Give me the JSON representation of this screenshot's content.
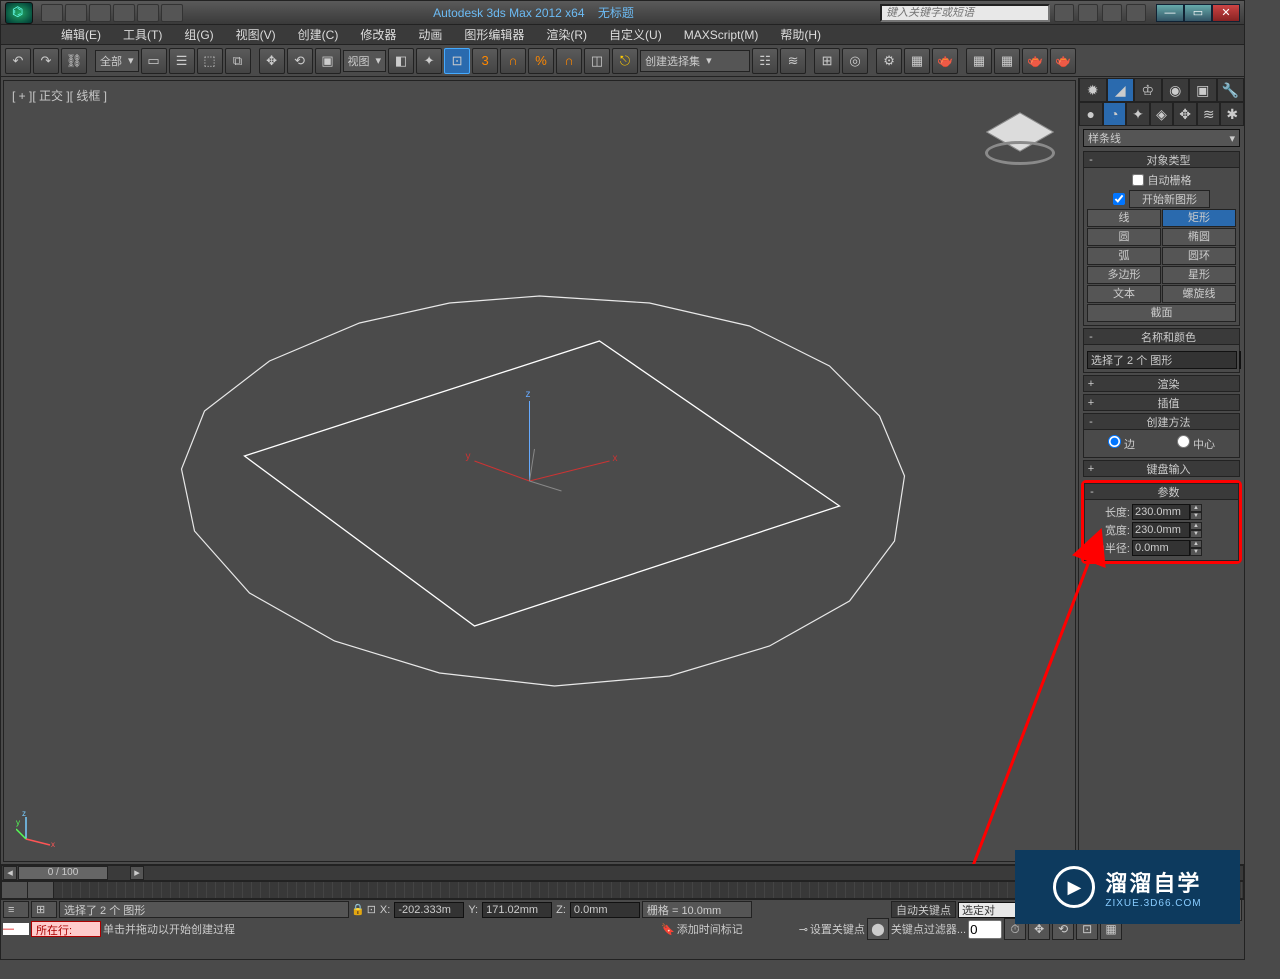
{
  "title": {
    "app": "Autodesk 3ds Max 2012 x64",
    "doc": "无标题"
  },
  "search_placeholder": "键入关键字或短语",
  "menu": [
    "编辑(E)",
    "工具(T)",
    "组(G)",
    "视图(V)",
    "创建(C)",
    "修改器",
    "动画",
    "图形编辑器",
    "渲染(R)",
    "自定义(U)",
    "MAXScript(M)",
    "帮助(H)"
  ],
  "toolbar": {
    "filter_all": "全部",
    "viewport_combo": "视图",
    "create_set": "创建选择集"
  },
  "viewport_label": "[ + ][ 正交 ][ 线框 ]",
  "cmd_panel": {
    "shape_type": "样条线",
    "rollout_objtype": "对象类型",
    "auto_grid": "自动栅格",
    "start_new": "开始新图形",
    "shapes": {
      "line": "线",
      "rect": "矩形",
      "circle": "圆",
      "ellipse": "椭圆",
      "arc": "弧",
      "donut": "圆环",
      "ngon": "多边形",
      "star": "星形",
      "text": "文本",
      "helix": "螺旋线",
      "section": "截面"
    },
    "rollout_name": "名称和颜色",
    "name_value": "选择了 2 个 图形",
    "rollout_render": "渲染",
    "rollout_interp": "插值",
    "rollout_create": "创建方法",
    "radio_edge": "边",
    "radio_center": "中心",
    "rollout_keyboard": "键盘输入",
    "rollout_params": "参数",
    "param_length": "长度:",
    "param_width": "宽度:",
    "param_corner": "角半径:",
    "val_length": "230.0mm",
    "val_width": "230.0mm",
    "val_corner": "0.0mm"
  },
  "timeline": {
    "handle": "0 / 100"
  },
  "status": {
    "sel": "选择了 2 个 图形",
    "x": "-202.333m",
    "y": "171.02mm",
    "z": "0.0mm",
    "grid": "栅格 = 10.0mm",
    "autokey": "自动关键点",
    "setkey": "设置关键点",
    "hint": "单击并拖动以开始创建过程",
    "addtm": "添加时间标记",
    "keyfilter": "关键点过滤器...",
    "selobj": "选定对",
    "nowat": "所在行:"
  },
  "watermark": {
    "big": "溜溜自学",
    "small": "ZIXUE.3D66.COM"
  }
}
